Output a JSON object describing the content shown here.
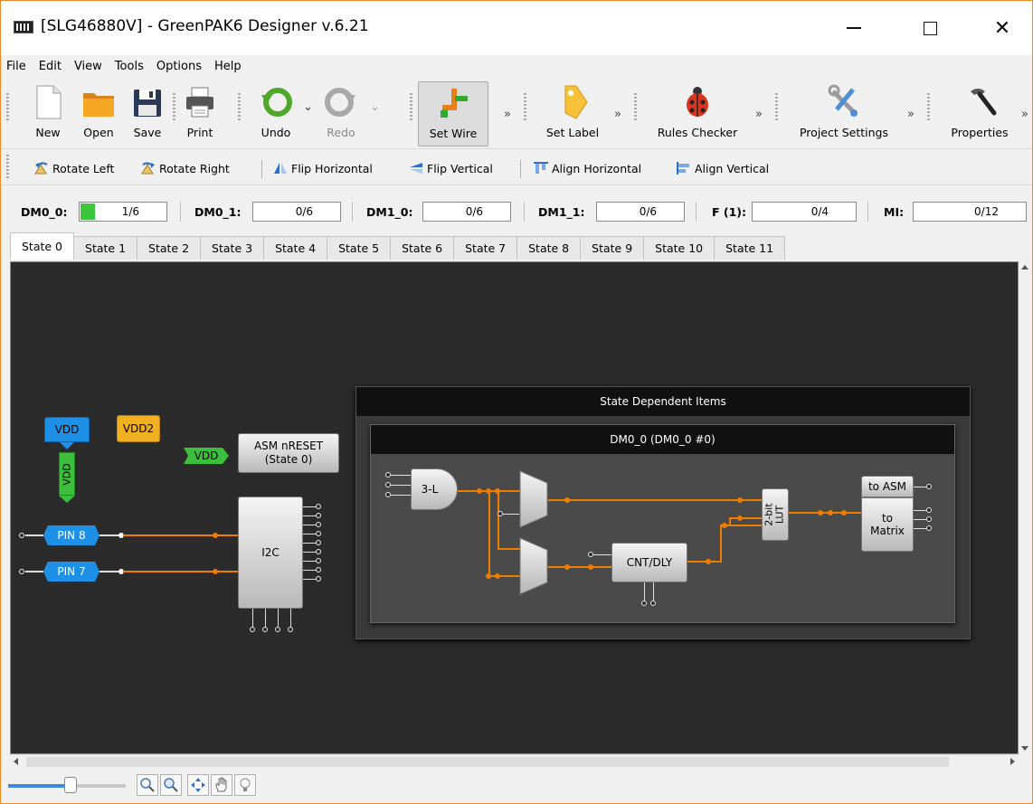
{
  "window": {
    "title": "[SLG46880V] - GreenPAK6 Designer v.6.21"
  },
  "menu": [
    "File",
    "Edit",
    "View",
    "Tools",
    "Options",
    "Help"
  ],
  "toolbar": {
    "new": "New",
    "open": "Open",
    "save": "Save",
    "print": "Print",
    "undo": "Undo",
    "redo": "Redo",
    "set_wire": "Set Wire",
    "set_label": "Set Label",
    "rules_checker": "Rules Checker",
    "project_settings": "Project Settings",
    "properties": "Properties",
    "more": "»"
  },
  "toolbar2": {
    "rotate_left": "Rotate Left",
    "rotate_right": "Rotate Right",
    "flip_horizontal": "Flip Horizontal",
    "flip_vertical": "Flip Vertical",
    "align_horizontal": "Align Horizontal",
    "align_vertical": "Align Vertical"
  },
  "resources": [
    {
      "label": "DM0_0:",
      "value": "1/6",
      "fill": 0.1667
    },
    {
      "label": "DM0_1:",
      "value": "0/6",
      "fill": 0
    },
    {
      "label": "DM1_0:",
      "value": "0/6",
      "fill": 0
    },
    {
      "label": "DM1_1:",
      "value": "0/6",
      "fill": 0
    },
    {
      "label": "F (1):",
      "value": "0/4",
      "fill": 0
    },
    {
      "label": "MI:",
      "value": "0/12",
      "fill": 0
    }
  ],
  "tabs": [
    "State 0",
    "State 1",
    "State 2",
    "State 3",
    "State 4",
    "State 5",
    "State 6",
    "State 7",
    "State 8",
    "State 9",
    "State 10",
    "State 11"
  ],
  "active_tab": "State 0",
  "diagram": {
    "vdd": "VDD",
    "vdd2": "VDD2",
    "vdd_vertical": "VDD",
    "vdd_arrow": "VDD",
    "asm_nreset_line1": "ASM nRESET",
    "asm_nreset_line2": "(State 0)",
    "pin8": "PIN 8",
    "pin7": "PIN 7",
    "i2c": "I2C",
    "state_dependent_title": "State Dependent Items",
    "dm_title": "DM0_0 (DM0_0 #0)",
    "lut3": "3-L",
    "cnt_dly": "CNT/DLY",
    "lut2_line1": "2-bit",
    "lut2_line2": "LUT",
    "to_asm": "to ASM",
    "to_matrix_line1": "to",
    "to_matrix_line2": "Matrix"
  },
  "colors": {
    "accent_orange": "#f07d00",
    "vdd_blue": "#1e90e6",
    "vdd2_yellow": "#f0b020",
    "vdd_green": "#3cbf3c",
    "pin_blue": "#1e90e6",
    "canvas_bg": "#2b2b2b"
  },
  "icons": {
    "new": "new-document-icon",
    "open": "folder-icon",
    "save": "floppy-disk-icon",
    "print": "printer-icon",
    "undo": "undo-arrow-icon",
    "redo": "redo-arrow-icon",
    "set_wire": "wire-icon",
    "set_label": "tag-icon",
    "rules_checker": "ladybug-icon",
    "project_settings": "tools-icon",
    "properties": "hammer-icon"
  }
}
